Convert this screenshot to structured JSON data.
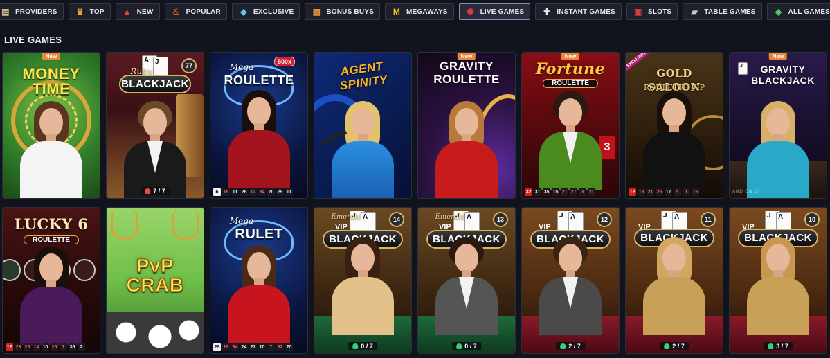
{
  "nav": [
    {
      "label": "PROVIDERS",
      "icon": "providers-icon",
      "glyph": "▤",
      "color": "#d6b98a",
      "active": false
    },
    {
      "label": "TOP",
      "icon": "crown-icon",
      "glyph": "♛",
      "color": "#f2a531",
      "active": false
    },
    {
      "label": "NEW",
      "icon": "new-icon",
      "glyph": "▲",
      "color": "#e1483b",
      "active": false
    },
    {
      "label": "POPULAR",
      "icon": "fire-icon",
      "glyph": "♨",
      "color": "#f05a22",
      "active": false
    },
    {
      "label": "EXCLUSIVE",
      "icon": "diamond-icon",
      "glyph": "◆",
      "color": "#5fc4f0",
      "active": false
    },
    {
      "label": "BONUS BUYS",
      "icon": "gift-icon",
      "glyph": "▦",
      "color": "#e4913a",
      "active": false
    },
    {
      "label": "MEGAWAYS",
      "icon": "megaways-icon",
      "glyph": "M",
      "color": "#f2c21a",
      "active": false
    },
    {
      "label": "LIVE GAMES",
      "icon": "roulette-chip-icon",
      "glyph": "✺",
      "color": "#e53a3a",
      "active": true
    },
    {
      "label": "INSTANT GAMES",
      "icon": "gamepad-icon",
      "glyph": "✚",
      "color": "#e8e8e8",
      "active": false
    },
    {
      "label": "SLOTS",
      "icon": "slot-machine-icon",
      "glyph": "▣",
      "color": "#d43b3b",
      "active": false
    },
    {
      "label": "TABLE GAMES",
      "icon": "cards-icon",
      "glyph": "▰",
      "color": "#c8c8d0",
      "active": false
    },
    {
      "label": "ALL GAMES",
      "icon": "all-games-icon",
      "glyph": "◈",
      "color": "#5ad06a",
      "active": false
    }
  ],
  "section_title": "LIVE GAMES",
  "games": [
    {
      "name": "money-time",
      "title": "MONEY TIME",
      "subtitle": "",
      "badge": "New",
      "ribbon": "",
      "results": [],
      "seats": ""
    },
    {
      "name": "ruby-blackjack",
      "title": "BLACKJACK",
      "subtitle": "Ruby",
      "badge": "",
      "ribbon": "",
      "table_no": "77",
      "results": [],
      "seats": "7 / 7"
    },
    {
      "name": "mega-roulette",
      "title": "ROULETTE",
      "subtitle": "Mega",
      "badge": "",
      "ribbon": "",
      "multiplier": "500x",
      "results": [
        "6",
        "18",
        "11",
        "26",
        "12",
        "34",
        "20",
        "29",
        "11"
      ],
      "seats": ""
    },
    {
      "name": "agent-spinity",
      "title": "AGENT SPINITY",
      "subtitle": "",
      "badge": "",
      "ribbon": "",
      "results": [],
      "seats": ""
    },
    {
      "name": "gravity-roulette",
      "title": "GRAVITY ROULETTE",
      "subtitle": "",
      "badge": "New",
      "ribbon": "",
      "results": [],
      "seats": ""
    },
    {
      "name": "fortune-roulette",
      "title": "Fortune",
      "subtitle": "ROULETTE",
      "badge": "New",
      "ribbon": "",
      "results": [
        "32",
        "31",
        "35",
        "15",
        "21",
        "27",
        "3",
        "11"
      ],
      "seats": ""
    },
    {
      "name": "gold-saloon-roulette-vip",
      "title": "GOLD SALOON",
      "subtitle": "ROULETTE VIP",
      "badge": "",
      "ribbon": "EXCLUSIVE",
      "results": [
        "12",
        "18",
        "21",
        "25",
        "17",
        "5",
        "1",
        "16"
      ],
      "seats": ""
    },
    {
      "name": "gravity-blackjack",
      "title": "GRAVITY BLACKJACK",
      "subtitle": "",
      "badge": "New",
      "ribbon": "",
      "felt": "AND ON 17",
      "results": [],
      "seats": ""
    },
    {
      "name": "lucky-6-roulette",
      "title": "LUCKY 6",
      "subtitle": "ROULETTE",
      "badge": "",
      "ribbon": "",
      "results": [
        "12",
        "23",
        "25",
        "14",
        "10",
        "25",
        "7",
        "35",
        "2"
      ],
      "seats": ""
    },
    {
      "name": "pvp-crab",
      "title": "PvP CRAB",
      "subtitle": "",
      "badge": "",
      "ribbon": "",
      "results": [],
      "seats": ""
    },
    {
      "name": "mega-rulet",
      "title": "RULET",
      "subtitle": "Mega",
      "badge": "",
      "ribbon": "",
      "results": [
        "28",
        "19",
        "34",
        "24",
        "22",
        "10",
        "7",
        "32",
        "20"
      ],
      "seats": ""
    },
    {
      "name": "vip-blackjack-14",
      "title": "BLACKJACK",
      "subtitle": "Emerald",
      "vip": "VIP",
      "table_no": "14",
      "badge": "",
      "ribbon": "",
      "results": [],
      "seats": "0 / 7"
    },
    {
      "name": "vip-blackjack-13",
      "title": "BLACKJACK",
      "subtitle": "Emerald",
      "vip": "VIP",
      "table_no": "13",
      "badge": "",
      "ribbon": "",
      "results": [],
      "seats": "0 / 7"
    },
    {
      "name": "vip-blackjack-12",
      "title": "BLACKJACK",
      "subtitle": "",
      "vip": "VIP",
      "table_no": "12",
      "badge": "",
      "ribbon": "",
      "results": [],
      "seats": "2 / 7"
    },
    {
      "name": "vip-blackjack-11",
      "title": "BLACKJACK",
      "subtitle": "",
      "vip": "VIP",
      "table_no": "11",
      "badge": "",
      "ribbon": "",
      "results": [],
      "seats": "2 / 7"
    },
    {
      "name": "vip-blackjack-10",
      "title": "BLACKJACK",
      "subtitle": "",
      "vip": "VIP",
      "table_no": "10",
      "badge": "",
      "ribbon": "",
      "results": [],
      "seats": "3 / 7"
    }
  ],
  "colors": {
    "background": "#12141d",
    "nav_button": "#1e212c",
    "badge_new": "#e8863a",
    "ribbon_exclusive": "#b61f7a",
    "gold_trim": "#d8b469"
  }
}
